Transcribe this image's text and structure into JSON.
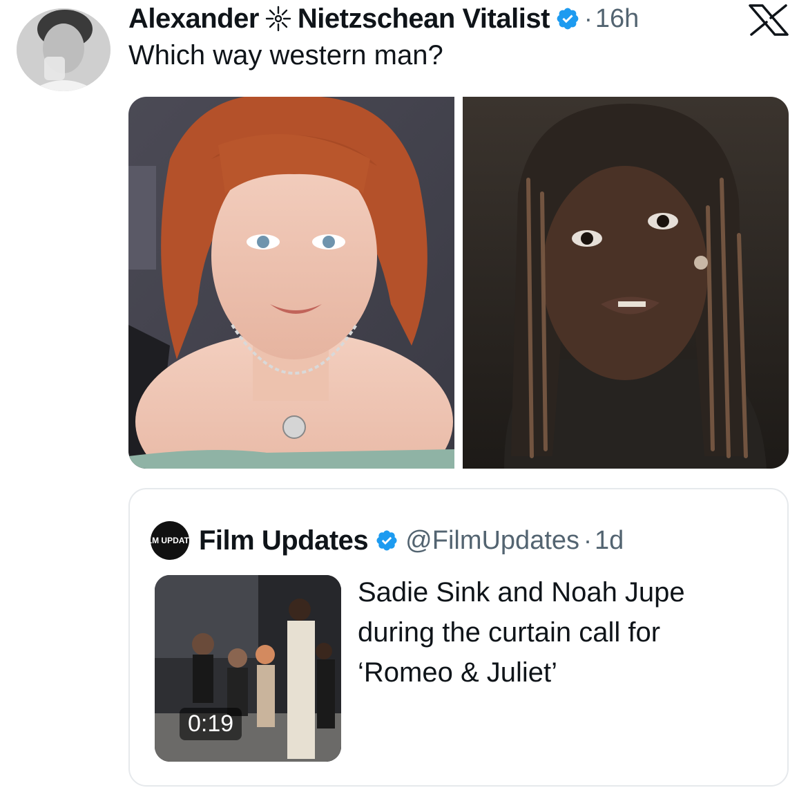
{
  "tweet": {
    "display_name_first": "Alexander",
    "display_name_second": "Nietzschean Vitalist",
    "name_symbol_icon": "sun-sparkle-icon",
    "verified_icon": "verified-badge-icon",
    "separator": "·",
    "time": "16h",
    "text": "Which way western man?",
    "platform_logo": "x-logo-icon"
  },
  "media": {
    "photos": [
      {
        "name": "left-photo"
      },
      {
        "name": "right-photo"
      }
    ]
  },
  "quote": {
    "avatar_text": "FILM UPDATES",
    "name": "Film Updates",
    "handle": "@FilmUpdates",
    "separator": "·",
    "time": "1d",
    "text": "Sadie Sink and Noah Jupe during the curtain call for ‘Romeo & Juliet’",
    "video_duration": "0:19"
  },
  "colors": {
    "text_primary": "#0f1419",
    "text_secondary": "#536471",
    "verified_blue": "#1d9bf0",
    "border": "#e6e9ec"
  }
}
